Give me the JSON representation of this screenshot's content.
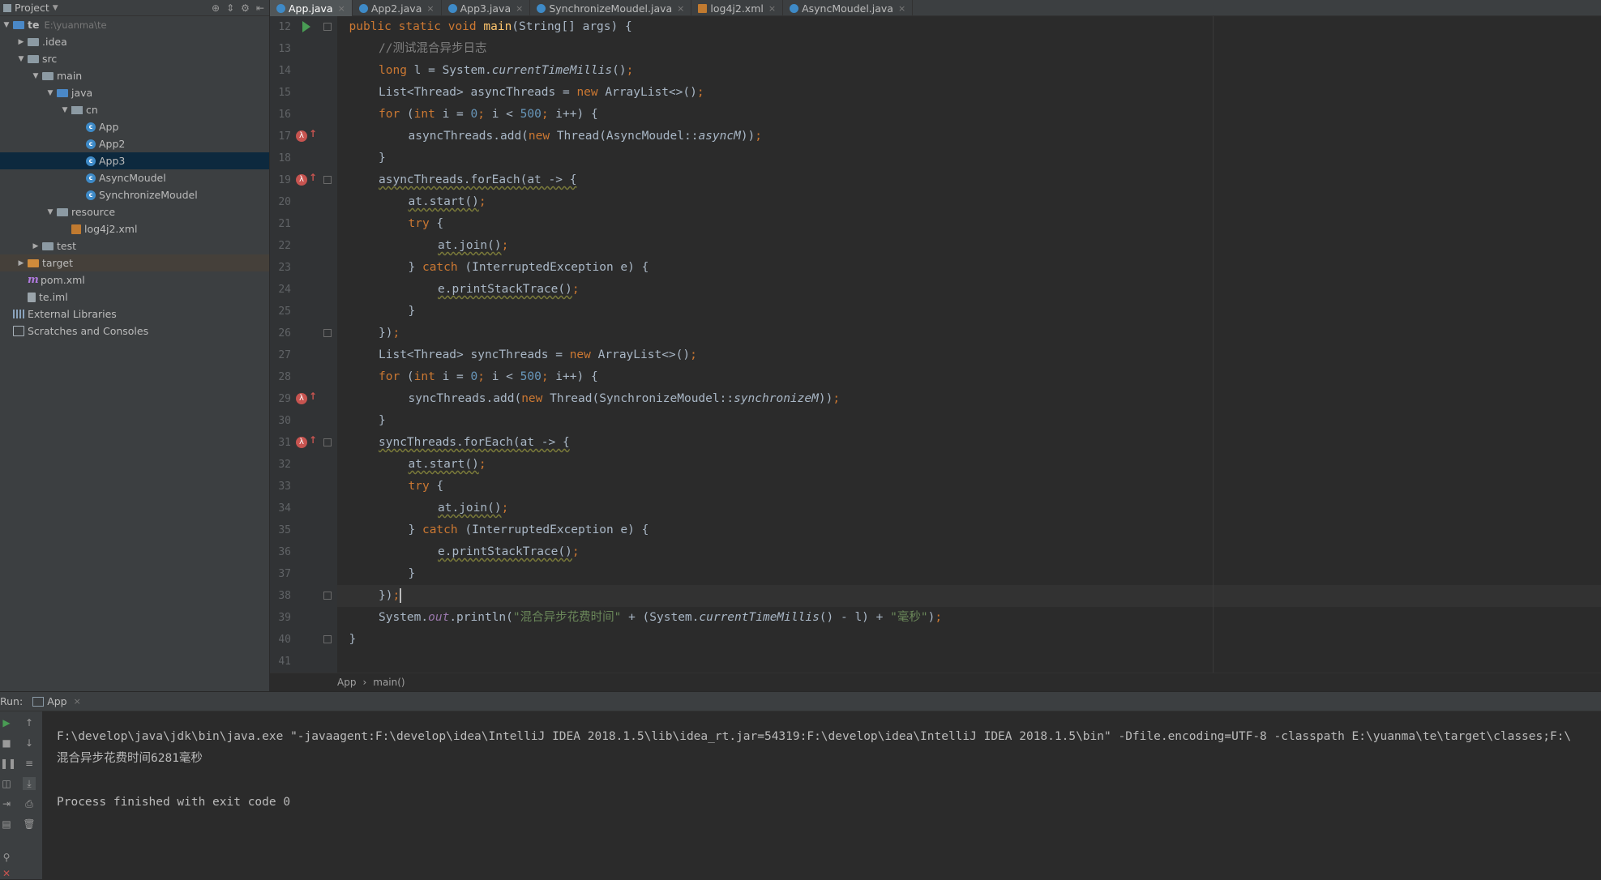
{
  "project_panel": {
    "title": "Project",
    "tree": [
      {
        "label": "te",
        "path": "E:\\yuanma\\te",
        "icon": "module-folder-icon",
        "arrow": "▼",
        "depth": 0
      },
      {
        "label": ".idea",
        "icon": "folder-icon",
        "arrow": "▶",
        "depth": 1
      },
      {
        "label": "src",
        "icon": "folder-icon",
        "arrow": "▼",
        "depth": 1
      },
      {
        "label": "main",
        "icon": "folder-icon",
        "arrow": "▼",
        "depth": 2
      },
      {
        "label": "java",
        "icon": "source-folder-icon",
        "arrow": "▼",
        "depth": 3
      },
      {
        "label": "cn",
        "icon": "package-icon",
        "arrow": "▼",
        "depth": 4
      },
      {
        "label": "App",
        "icon": "class-icon",
        "arrow": "",
        "depth": 5
      },
      {
        "label": "App2",
        "icon": "class-icon",
        "arrow": "",
        "depth": 5
      },
      {
        "label": "App3",
        "icon": "class-icon",
        "arrow": "",
        "depth": 5,
        "selected": true
      },
      {
        "label": "AsyncMoudel",
        "icon": "class-icon",
        "arrow": "",
        "depth": 5
      },
      {
        "label": "SynchronizeMoudel",
        "icon": "class-icon",
        "arrow": "",
        "depth": 5
      },
      {
        "label": "resource",
        "icon": "resource-folder-icon",
        "arrow": "▼",
        "depth": 3
      },
      {
        "label": "log4j2.xml",
        "icon": "xml-file-icon",
        "arrow": "",
        "depth": 4
      },
      {
        "label": "test",
        "icon": "folder-icon",
        "arrow": "▶",
        "depth": 2
      },
      {
        "label": "target",
        "icon": "excluded-folder-icon",
        "arrow": "▶",
        "depth": 1,
        "excluded": true
      },
      {
        "label": "pom.xml",
        "icon": "maven-file-icon",
        "arrow": "",
        "depth": 1
      },
      {
        "label": "te.iml",
        "icon": "iml-file-icon",
        "arrow": "",
        "depth": 1
      },
      {
        "label": "External Libraries",
        "icon": "libraries-icon",
        "arrow": "",
        "depth": 0
      },
      {
        "label": "Scratches and Consoles",
        "icon": "scratches-icon",
        "arrow": "",
        "depth": 0
      }
    ]
  },
  "editor_tabs": [
    {
      "label": "App.java",
      "active": true,
      "icon": "class-icon"
    },
    {
      "label": "App2.java",
      "active": false,
      "icon": "class-icon"
    },
    {
      "label": "App3.java",
      "active": false,
      "icon": "class-icon"
    },
    {
      "label": "SynchronizeMoudel.java",
      "active": false,
      "icon": "class-icon"
    },
    {
      "label": "log4j2.xml",
      "active": false,
      "icon": "xml-file-icon"
    },
    {
      "label": "AsyncMoudel.java",
      "active": false,
      "icon": "class-icon"
    }
  ],
  "editor": {
    "current_line": 38,
    "lines": [
      {
        "n": 12,
        "marker": "run",
        "fold": true,
        "indent": 1,
        "code": [
          [
            "kw",
            "public static void "
          ],
          [
            "fn",
            "main"
          ],
          [
            "",
            "(String[] args) {"
          ]
        ]
      },
      {
        "n": 13,
        "indent": 2,
        "code": [
          [
            "cmt",
            "//测试混合异步日志"
          ]
        ]
      },
      {
        "n": 14,
        "indent": 2,
        "code": [
          [
            "kw",
            "long "
          ],
          [
            "",
            "l = System."
          ],
          [
            "it",
            "currentTimeMillis"
          ],
          [
            "",
            "()"
          ],
          [
            "kw",
            ";"
          ]
        ]
      },
      {
        "n": 15,
        "indent": 2,
        "code": [
          [
            "",
            "List<Thread> asyncThreads = "
          ],
          [
            "kw",
            "new "
          ],
          [
            "",
            "ArrayList<>()"
          ],
          [
            "kw",
            ";"
          ]
        ]
      },
      {
        "n": 16,
        "indent": 2,
        "code": [
          [
            "kw",
            "for "
          ],
          [
            "",
            "("
          ],
          [
            "kw",
            "int "
          ],
          [
            "",
            "i = "
          ],
          [
            "num",
            "0"
          ],
          [
            "kw",
            "; "
          ],
          [
            "",
            "i < "
          ],
          [
            "num",
            "500"
          ],
          [
            "kw",
            "; "
          ],
          [
            "",
            "i++) {"
          ]
        ]
      },
      {
        "n": 17,
        "marker": "lambda",
        "indent": 3,
        "code": [
          [
            "",
            "asyncThreads.add("
          ],
          [
            "kw",
            "new "
          ],
          [
            "",
            "Thread(AsyncMoudel::"
          ],
          [
            "it",
            "asyncM"
          ],
          [
            "",
            "))"
          ],
          [
            "kw",
            ";"
          ]
        ]
      },
      {
        "n": 18,
        "indent": 2,
        "code": [
          [
            "",
            "}"
          ]
        ]
      },
      {
        "n": 19,
        "marker": "lambda",
        "fold": true,
        "indent": 2,
        "code": [
          [
            "warn",
            "asyncThreads.forEach(at -> {"
          ]
        ]
      },
      {
        "n": 20,
        "indent": 3,
        "code": [
          [
            "warn",
            "at.start()"
          ],
          [
            "kw",
            ";"
          ]
        ]
      },
      {
        "n": 21,
        "indent": 3,
        "code": [
          [
            "kw",
            "try "
          ],
          [
            "",
            "{"
          ]
        ]
      },
      {
        "n": 22,
        "indent": 4,
        "code": [
          [
            "warn",
            "at.join()"
          ],
          [
            "kw",
            ";"
          ]
        ]
      },
      {
        "n": 23,
        "indent": 3,
        "code": [
          [
            "",
            "} "
          ],
          [
            "kw",
            "catch "
          ],
          [
            "",
            "(InterruptedException e) {"
          ]
        ]
      },
      {
        "n": 24,
        "indent": 4,
        "code": [
          [
            "warn",
            "e.printStackTrace()"
          ],
          [
            "kw",
            ";"
          ]
        ]
      },
      {
        "n": 25,
        "indent": 3,
        "code": [
          [
            "",
            "}"
          ]
        ]
      },
      {
        "n": 26,
        "fold": true,
        "indent": 2,
        "code": [
          [
            "",
            "})"
          ],
          [
            "kw",
            ";"
          ]
        ]
      },
      {
        "n": 27,
        "indent": 2,
        "code": [
          [
            "",
            "List<Thread> syncThreads = "
          ],
          [
            "kw",
            "new "
          ],
          [
            "",
            "ArrayList<>()"
          ],
          [
            "kw",
            ";"
          ]
        ]
      },
      {
        "n": 28,
        "indent": 2,
        "code": [
          [
            "kw",
            "for "
          ],
          [
            "",
            "("
          ],
          [
            "kw",
            "int "
          ],
          [
            "",
            "i = "
          ],
          [
            "num",
            "0"
          ],
          [
            "kw",
            "; "
          ],
          [
            "",
            "i < "
          ],
          [
            "num",
            "500"
          ],
          [
            "kw",
            "; "
          ],
          [
            "",
            "i++) {"
          ]
        ]
      },
      {
        "n": 29,
        "marker": "lambda",
        "indent": 3,
        "code": [
          [
            "",
            "syncThreads.add("
          ],
          [
            "kw",
            "new "
          ],
          [
            "",
            "Thread(SynchronizeMoudel::"
          ],
          [
            "it",
            "synchronizeM"
          ],
          [
            "",
            "))"
          ],
          [
            "kw",
            ";"
          ]
        ]
      },
      {
        "n": 30,
        "indent": 2,
        "code": [
          [
            "",
            "}"
          ]
        ]
      },
      {
        "n": 31,
        "marker": "lambda",
        "fold": true,
        "indent": 2,
        "code": [
          [
            "warn",
            "syncThreads.forEach(at -> {"
          ]
        ]
      },
      {
        "n": 32,
        "indent": 3,
        "code": [
          [
            "warn",
            "at.start()"
          ],
          [
            "kw",
            ";"
          ]
        ]
      },
      {
        "n": 33,
        "indent": 3,
        "code": [
          [
            "kw",
            "try "
          ],
          [
            "",
            "{"
          ]
        ]
      },
      {
        "n": 34,
        "indent": 4,
        "code": [
          [
            "warn",
            "at.join()"
          ],
          [
            "kw",
            ";"
          ]
        ]
      },
      {
        "n": 35,
        "indent": 3,
        "code": [
          [
            "",
            "} "
          ],
          [
            "kw",
            "catch "
          ],
          [
            "",
            "(InterruptedException e) {"
          ]
        ]
      },
      {
        "n": 36,
        "indent": 4,
        "code": [
          [
            "warn",
            "e.printStackTrace()"
          ],
          [
            "kw",
            ";"
          ]
        ]
      },
      {
        "n": 37,
        "indent": 3,
        "code": [
          [
            "",
            "}"
          ]
        ]
      },
      {
        "n": 38,
        "fold": true,
        "indent": 2,
        "caret": true,
        "code": [
          [
            "",
            "})"
          ],
          [
            "kw",
            ";"
          ]
        ]
      },
      {
        "n": 39,
        "indent": 2,
        "code": [
          [
            "",
            "System."
          ],
          [
            "sfld",
            "out"
          ],
          [
            "",
            ".println("
          ],
          [
            "str",
            "\"混合异步花费时间\""
          ],
          [
            "",
            " + (System."
          ],
          [
            "it",
            "currentTimeMillis"
          ],
          [
            "",
            "() - l) + "
          ],
          [
            "str",
            "\"毫秒\""
          ],
          [
            "",
            ")"
          ],
          [
            "kw",
            ";"
          ]
        ]
      },
      {
        "n": 40,
        "fold": true,
        "indent": 1,
        "code": [
          [
            "",
            "}"
          ]
        ]
      },
      {
        "n": 41,
        "indent": 0,
        "code": [
          [
            "",
            "}"
          ]
        ]
      }
    ]
  },
  "breadcrumb": {
    "items": [
      "App",
      "main()"
    ],
    "separator": "›"
  },
  "run_panel": {
    "label": "Run:",
    "tab_label": "App",
    "console_lines": [
      "F:\\develop\\java\\jdk\\bin\\java.exe \"-javaagent:F:\\develop\\idea\\IntelliJ IDEA 2018.1.5\\lib\\idea_rt.jar=54319:F:\\develop\\idea\\IntelliJ IDEA 2018.1.5\\bin\" -Dfile.encoding=UTF-8 -classpath E:\\yuanma\\te\\target\\classes;F:\\",
      "混合异步花费时间6281毫秒",
      "",
      "Process finished with exit code 0"
    ]
  },
  "colors": {
    "accent": "#4a88c7",
    "keyword": "#cc7832",
    "number": "#6897bb",
    "string": "#6a8759",
    "comment": "#808080",
    "method_decl": "#ffc66d",
    "error_marker": "#c75450",
    "run_green": "#499c54"
  }
}
